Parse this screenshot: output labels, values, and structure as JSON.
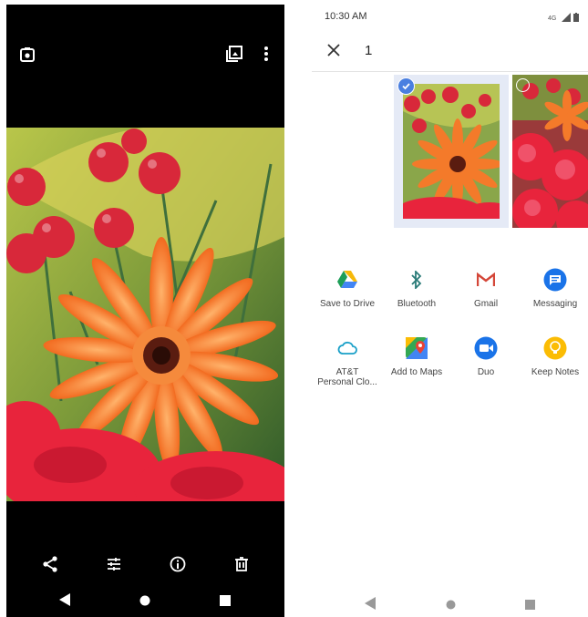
{
  "viewer": {
    "top_icons": [
      "camera-icon",
      "gallery-icon",
      "more-vert-icon"
    ],
    "actions": [
      "share-icon",
      "edit-adjust-icon",
      "info-icon",
      "delete-icon"
    ],
    "nav": [
      "back-icon",
      "home-icon",
      "recents-icon"
    ]
  },
  "status": {
    "time": "10:30 AM",
    "icons": [
      "4g-icon",
      "signal-icon",
      "battery-icon"
    ]
  },
  "share": {
    "selected_count": "1",
    "apps": [
      {
        "label": "Save to Drive",
        "icon": "drive-icon"
      },
      {
        "label": "Bluetooth",
        "icon": "bluetooth-icon"
      },
      {
        "label": "Gmail",
        "icon": "gmail-icon"
      },
      {
        "label": "Messaging",
        "icon": "messaging-icon"
      },
      {
        "label": "AT&T Personal Clo...",
        "label_line1": "AT&T",
        "label_line2": "Personal Clo...",
        "icon": "cloud-icon"
      },
      {
        "label": "Add to Maps",
        "icon": "maps-icon"
      },
      {
        "label": "Duo",
        "icon": "duo-icon"
      },
      {
        "label": "Keep Notes",
        "icon": "keep-icon"
      }
    ]
  },
  "colors": {
    "accent": "#4a7fe0",
    "selection_bg": "#e5eaf6",
    "viewer_bg": "#000000"
  }
}
